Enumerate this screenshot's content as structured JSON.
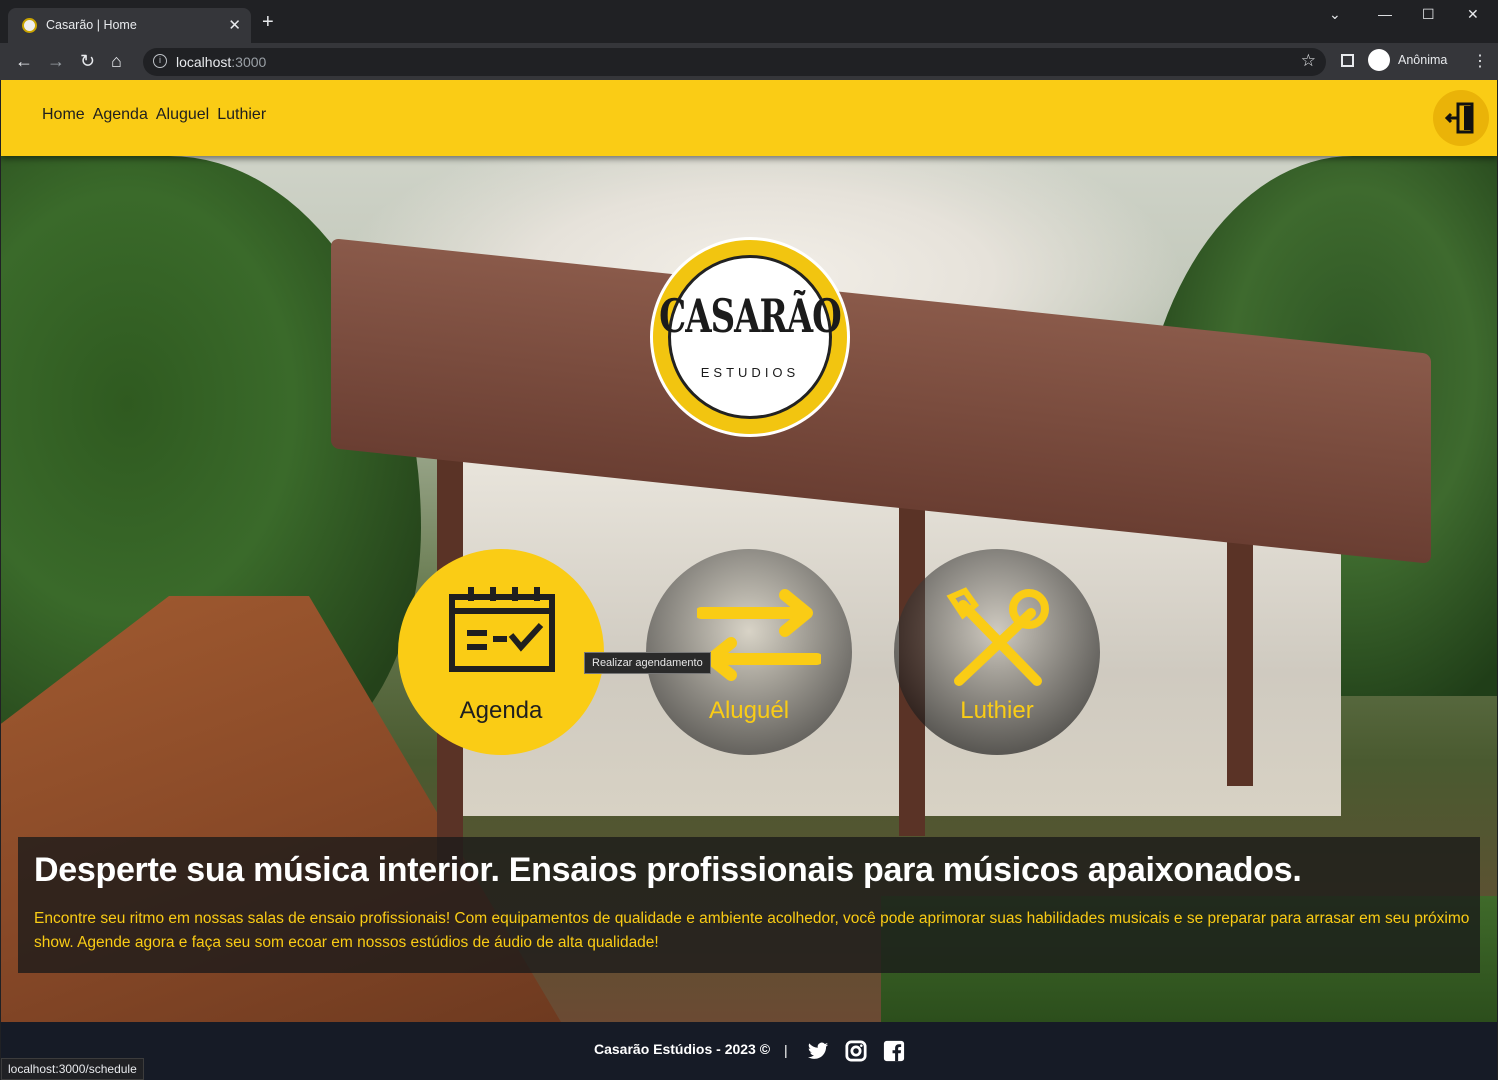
{
  "browser": {
    "tab_title": "Casarão | Home",
    "url_host": "localhost",
    "url_port": ":3000",
    "profile_name": "Anônima",
    "status_url": "localhost:3000/schedule"
  },
  "header": {
    "nav": [
      "Home",
      "Agenda",
      "Aluguel",
      "Luthier"
    ]
  },
  "logo": {
    "brand": "CASARÃO",
    "sub": "ESTUDIOS"
  },
  "cards": {
    "agenda": "Agenda",
    "aluguel": "Aluguél",
    "luthier": "Luthier"
  },
  "tooltip": "Realizar agendamento",
  "banner": {
    "title": "Desperte sua música interior. Ensaios profissionais para músicos apaixonados.",
    "text": "Encontre seu ritmo em nossas salas de ensaio profissionais! Com equipamentos de qualidade e ambiente acolhedor, você pode aprimorar suas habilidades musicais e se preparar para arrasar em seu próximo show. Agende agora e faça seu som ecoar em nossos estúdios de áudio de alta qualidade!"
  },
  "footer": {
    "copyright": "Casarão Estúdios - 2023 ©",
    "separator": "|"
  },
  "colors": {
    "accent": "#facc15",
    "footer_bg": "#161b26"
  }
}
